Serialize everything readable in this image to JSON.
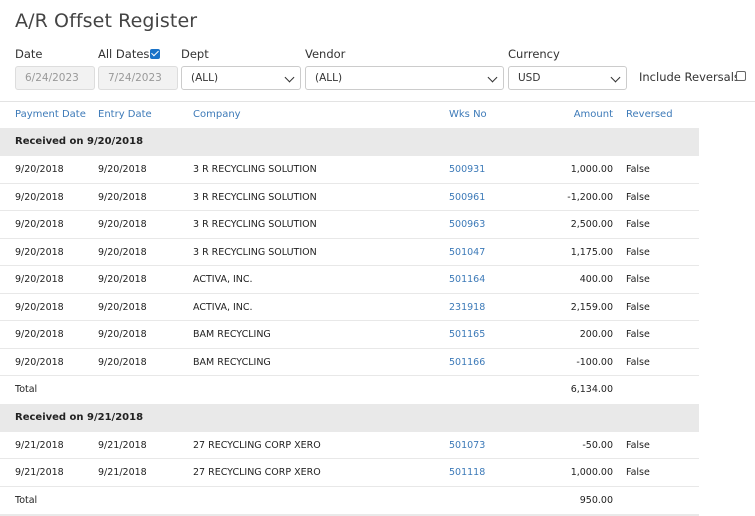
{
  "page": {
    "title": "A/R Offset Register"
  },
  "filters": {
    "date_label": "Date",
    "date_from": "6/24/2023",
    "all_dates_label": "All Dates",
    "all_dates_checked": true,
    "date_to": "7/24/2023",
    "dept_label": "Dept",
    "dept_value": "(ALL)",
    "vendor_label": "Vendor",
    "vendor_value": "(ALL)",
    "currency_label": "Currency",
    "currency_value": "USD",
    "include_reversals_label": "Include Reversals",
    "include_reversals_checked": false
  },
  "table": {
    "columns": [
      "Payment Date",
      "Entry Date",
      "Company",
      "Wks No",
      "Amount",
      "Reversed"
    ],
    "groups": [
      {
        "header": "Received on 9/20/2018",
        "rows": [
          [
            "9/20/2018",
            "9/20/2018",
            "3 R RECYCLING SOLUTION",
            "500931",
            "1,000.00",
            "False"
          ],
          [
            "9/20/2018",
            "9/20/2018",
            "3 R RECYCLING SOLUTION",
            "500961",
            "-1,200.00",
            "False"
          ],
          [
            "9/20/2018",
            "9/20/2018",
            "3 R RECYCLING SOLUTION",
            "500963",
            "2,500.00",
            "False"
          ],
          [
            "9/20/2018",
            "9/20/2018",
            "3 R RECYCLING SOLUTION",
            "501047",
            "1,175.00",
            "False"
          ],
          [
            "9/20/2018",
            "9/20/2018",
            "ACTIVA, INC.",
            "501164",
            "400.00",
            "False"
          ],
          [
            "9/20/2018",
            "9/20/2018",
            "ACTIVA, INC.",
            "231918",
            "2,159.00",
            "False"
          ],
          [
            "9/20/2018",
            "9/20/2018",
            "BAM RECYCLING",
            "501165",
            "200.00",
            "False"
          ],
          [
            "9/20/2018",
            "9/20/2018",
            "BAM RECYCLING",
            "501166",
            "-100.00",
            "False"
          ]
        ],
        "total_label": "Total",
        "total": "6,134.00"
      },
      {
        "header": "Received on 9/21/2018",
        "rows": [
          [
            "9/21/2018",
            "9/21/2018",
            "27 RECYCLING CORP XERO",
            "501073",
            "-50.00",
            "False"
          ],
          [
            "9/21/2018",
            "9/21/2018",
            "27 RECYCLING CORP XERO",
            "501118",
            "1,000.00",
            "False"
          ]
        ],
        "total_label": "Total",
        "total": "950.00"
      }
    ]
  },
  "colors": {
    "link": "#3d7ab8",
    "group_bg": "#e9e9e9",
    "accent": "#1a73c8"
  }
}
